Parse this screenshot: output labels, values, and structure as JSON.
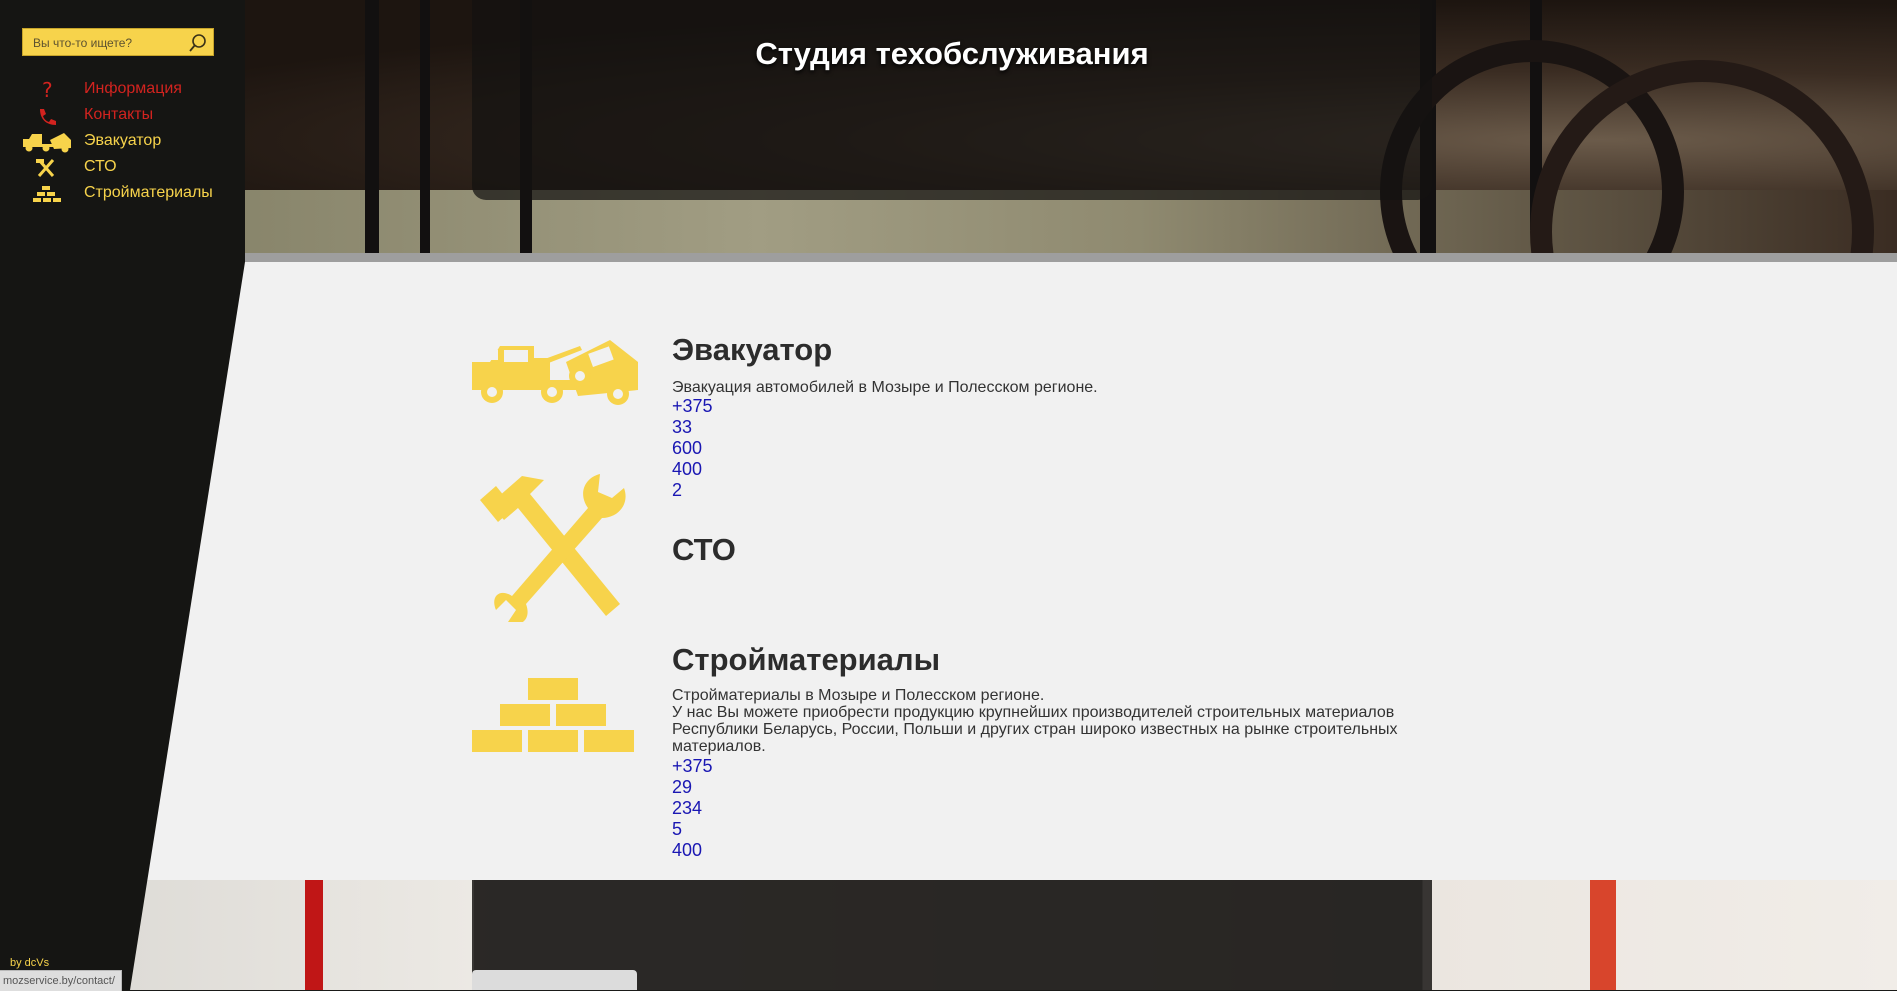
{
  "header": {
    "title": "Студия техобслуживания"
  },
  "search": {
    "placeholder": "Вы что-то ищете?",
    "value": ""
  },
  "sidebar": {
    "items": [
      {
        "label": "Информация",
        "icon": "question-icon",
        "color": "#d2231f"
      },
      {
        "label": "Контакты",
        "icon": "phone-icon",
        "color": "#d2231f"
      },
      {
        "label": "Эвакуатор",
        "icon": "tow-truck-icon",
        "color": "#f7d34b"
      },
      {
        "label": "СТО",
        "icon": "tools-icon",
        "color": "#f7d34b"
      },
      {
        "label": "Стройматериалы",
        "icon": "bricks-icon",
        "color": "#f7d34b"
      }
    ]
  },
  "sections": [
    {
      "title": "Эвакуатор",
      "icon": "tow-truck-icon",
      "description": "Эвакуация автомобилей в Мозыре и Полесском регионе.",
      "phone": "+375 33 600 400 2"
    },
    {
      "title": "СТО",
      "icon": "tools-icon"
    },
    {
      "title": "Стройматериалы",
      "icon": "bricks-icon",
      "description_lines": [
        "Стройматериалы в Мозыре и Полесском регионе.",
        "У нас Вы можете приобрести продукцию крупнейших производителей строительных материалов",
        "Республики Беларусь, России, Польши и других стран широко известных на рынке строительных",
        "материалов."
      ],
      "phone": "+375 29 234 5 400"
    }
  ],
  "footer": {
    "credit": "by dcVs"
  },
  "statusbar": {
    "url": "mozservice.by/contact/"
  },
  "colors": {
    "accent": "#f7d34b",
    "nav_red": "#d2231f",
    "phone_link": "#1a17b3",
    "sidebar_bg": "#151513"
  }
}
